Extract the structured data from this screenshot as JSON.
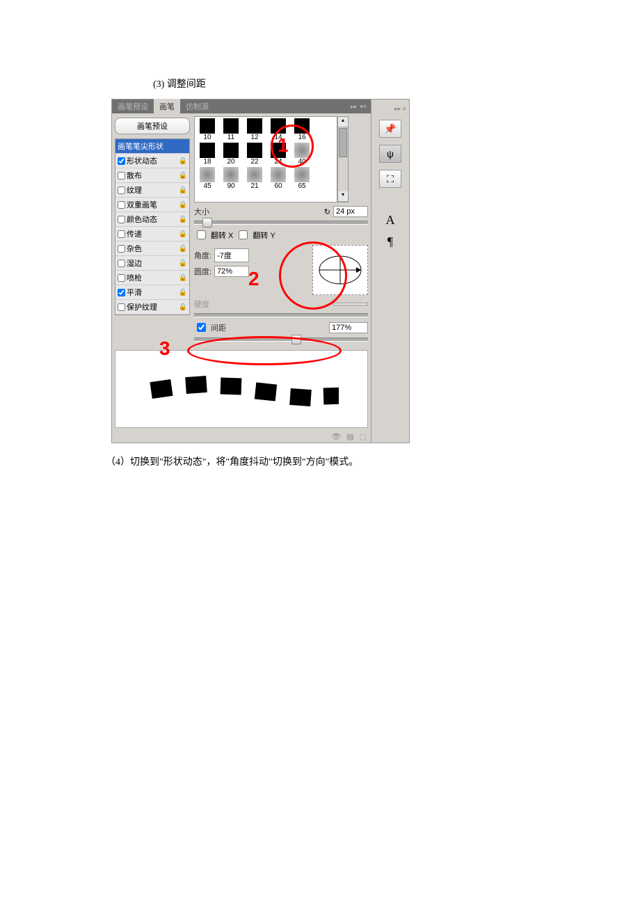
{
  "doc": {
    "step3": "(3) 调整间距",
    "step4": "（4）切换到\"形状动态\"，将\"角度抖动\"切换到\"方向\"模式。"
  },
  "tabs": {
    "t1": "画笔预设",
    "t2": "画笔",
    "t3": "仿制源"
  },
  "btn": {
    "preset": "画笔预设"
  },
  "opts": {
    "tip": "画笔笔尖形状",
    "shape": "形状动态",
    "scatter": "散布",
    "texture": "纹理",
    "dual": "双重画笔",
    "color": "颜色动态",
    "transfer": "传递",
    "noise": "杂色",
    "wet": "湿边",
    "air": "喷枪",
    "smooth": "平滑",
    "protect": "保护纹理"
  },
  "brushes": {
    "r1": [
      "10",
      "11",
      "12",
      "14",
      "16"
    ],
    "r2": [
      "18",
      "20",
      "22",
      "24",
      "40"
    ],
    "r3": [
      "45",
      "90",
      "21",
      "60",
      "65"
    ]
  },
  "labels": {
    "size": "大小",
    "flipx": "翻转 X",
    "flipy": "翻转 Y",
    "angle": "角度:",
    "round": "圆度:",
    "hard": "硬度",
    "spacing": "间距"
  },
  "vals": {
    "size": "24 px",
    "angle": "-7度",
    "round": "72%",
    "spacing": "177%"
  },
  "annot": {
    "n1": "1",
    "n2": "2",
    "n3": "3"
  },
  "dock": {
    "a": "A",
    "p": "¶"
  }
}
